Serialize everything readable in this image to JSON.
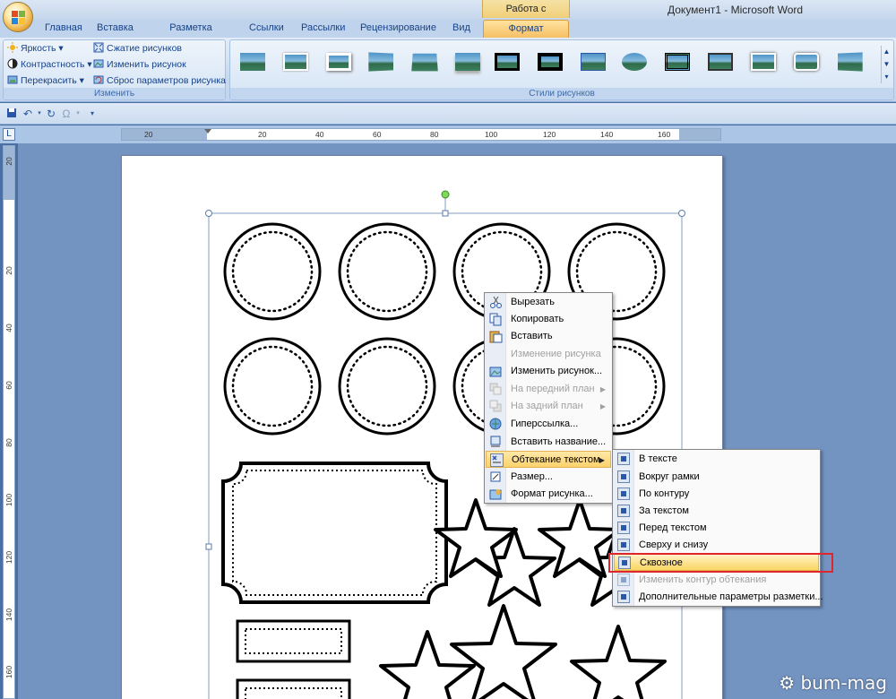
{
  "window": {
    "title": "Документ1 - Microsoft Word",
    "context_group": "Работа с рисунками"
  },
  "tabs": [
    {
      "label": "Главная"
    },
    {
      "label": "Вставка"
    },
    {
      "label": "Разметка страницы"
    },
    {
      "label": "Ссылки"
    },
    {
      "label": "Рассылки"
    },
    {
      "label": "Рецензирование"
    },
    {
      "label": "Вид"
    },
    {
      "label": "Формат",
      "active": true
    }
  ],
  "ribbon": {
    "adjust": {
      "label": "Изменить",
      "brightness": "Яркость",
      "contrast": "Контрастность",
      "recolor": "Перекрасить",
      "compress": "Сжатие рисунков",
      "change": "Изменить рисунок",
      "reset": "Сброс параметров рисунка"
    },
    "styles": {
      "label": "Стили рисунков"
    }
  },
  "ruler": {
    "h_numbers": [
      "20",
      "20",
      "40",
      "60",
      "80",
      "100",
      "120",
      "140",
      "160"
    ],
    "v_numbers": [
      "20",
      "20",
      "40",
      "60",
      "80",
      "100",
      "120",
      "140",
      "160"
    ]
  },
  "context_menu": {
    "items": [
      {
        "label": "Вырезать",
        "enabled": true,
        "icon": "scissors-icon"
      },
      {
        "label": "Копировать",
        "enabled": true,
        "icon": "copy-icon"
      },
      {
        "label": "Вставить",
        "enabled": true,
        "icon": "paste-icon"
      },
      {
        "label": "Изменение рисунка",
        "enabled": false,
        "icon": ""
      },
      {
        "label": "Изменить рисунок...",
        "enabled": true,
        "icon": "change-picture-icon"
      },
      {
        "label": "На передний план",
        "enabled": false,
        "icon": "bring-forward-icon",
        "submenu": true
      },
      {
        "label": "На задний план",
        "enabled": false,
        "icon": "send-backward-icon",
        "submenu": true
      },
      {
        "label": "Гиперссылка...",
        "enabled": true,
        "icon": "hyperlink-icon"
      },
      {
        "label": "Вставить название...",
        "enabled": true,
        "icon": "caption-icon"
      },
      {
        "label": "Обтекание текстом",
        "enabled": true,
        "icon": "text-wrap-icon",
        "submenu": true,
        "highlighted": true
      },
      {
        "label": "Размер...",
        "enabled": true,
        "icon": "size-icon"
      },
      {
        "label": "Формат рисунка...",
        "enabled": true,
        "icon": "format-picture-icon"
      }
    ]
  },
  "wrap_submenu": {
    "items": [
      {
        "label": "В тексте",
        "enabled": true
      },
      {
        "label": "Вокруг рамки",
        "enabled": true
      },
      {
        "label": "По контуру",
        "enabled": true
      },
      {
        "label": "За текстом",
        "enabled": true
      },
      {
        "label": "Перед текстом",
        "enabled": true
      },
      {
        "label": "Сверху и снизу",
        "enabled": true
      },
      {
        "label": "Сквозное",
        "enabled": true,
        "highlighted": true
      },
      {
        "label": "Изменить контур обтекания",
        "enabled": false
      },
      {
        "label": "Дополнительные параметры разметки...",
        "enabled": true
      }
    ]
  },
  "watermark": "bum-mag",
  "colors": {
    "accent_tab": "#f6bf63",
    "highlight_frame": "#e0262c",
    "selection_handle_rotate": "#7ed957"
  }
}
